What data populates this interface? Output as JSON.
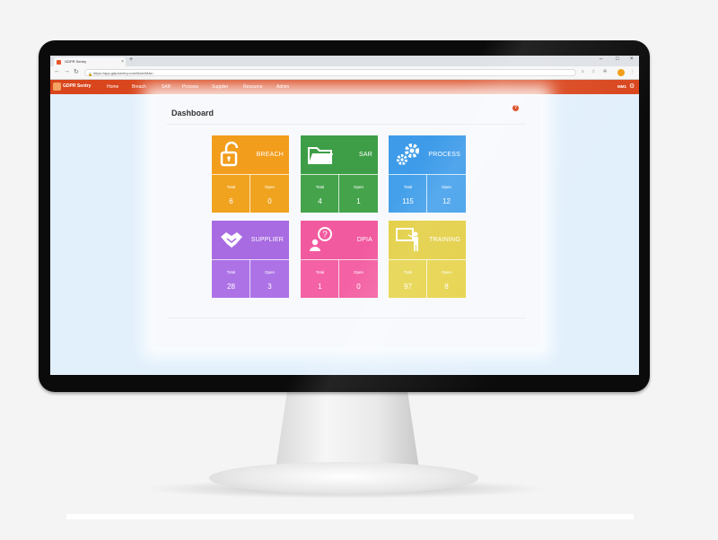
{
  "browser": {
    "tab_title": "GDPR Sentry",
    "tab_close": "×",
    "new_tab": "+",
    "url": "https://app.gdprsentry.com/Main/Main",
    "window_controls": [
      "–",
      "□",
      "×"
    ]
  },
  "app": {
    "brand": "GDPR Sentry",
    "nav": [
      "Home",
      "Breach",
      "SAR",
      "Process",
      "Supplier",
      "Resource",
      "Admin"
    ],
    "user": "MM1",
    "accent": "#d9451c"
  },
  "page": {
    "title": "Dashboard",
    "help": "?"
  },
  "cards": [
    {
      "name": "BREACH",
      "icon": "unlocked-padlock-icon",
      "total_label": "Total",
      "open_label": "Open",
      "total": "6",
      "open": "0",
      "color_top": "#f29d1c",
      "color_bot": "#f0a31f"
    },
    {
      "name": "SAR",
      "icon": "folder-icon",
      "total_label": "Total",
      "open_label": "Open",
      "total": "4",
      "open": "1",
      "color_top": "#3e9e47",
      "color_bot": "#45a34c"
    },
    {
      "name": "PROCESS",
      "icon": "gears-icon",
      "total_label": "Total",
      "open_label": "Open",
      "total": "115",
      "open": "12",
      "color_top": "#3d9be9",
      "color_bot": "#44a0ea"
    },
    {
      "name": "SUPPLIER",
      "icon": "handshake-icon",
      "total_label": "Total",
      "open_label": "Open",
      "total": "28",
      "open": "3",
      "color_top": "#a86be2",
      "color_bot": "#ad72e6"
    },
    {
      "name": "DPIA",
      "icon": "person-question-icon",
      "total_label": "Total",
      "open_label": "Open",
      "total": "1",
      "open": "0",
      "color_top": "#f25a9f",
      "color_bot": "#f461a4"
    },
    {
      "name": "TRAINING",
      "icon": "presenter-board-icon",
      "total_label": "Total",
      "open_label": "Open",
      "total": "97",
      "open": "8",
      "color_top": "#e3cf45",
      "color_bot": "#e6d44d"
    }
  ]
}
